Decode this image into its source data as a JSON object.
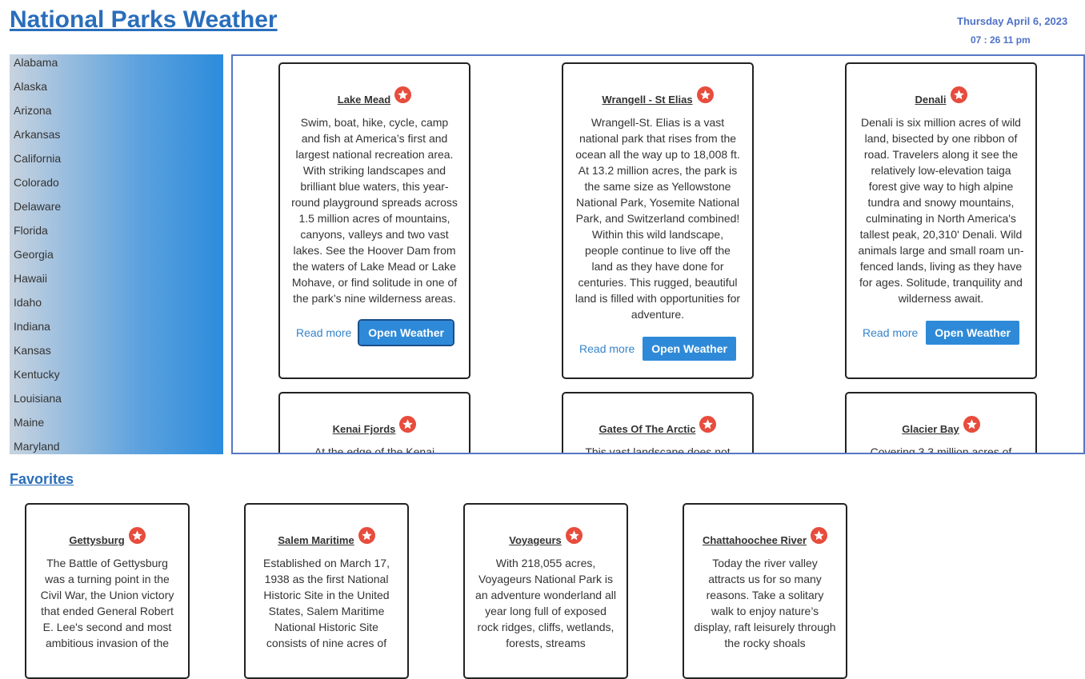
{
  "header": {
    "title": "National Parks Weather",
    "date": "Thursday April 6, 2023",
    "time": "07 : 26 11 pm"
  },
  "states": [
    "Alabama",
    "Alaska",
    "Arizona",
    "Arkansas",
    "California",
    "Colorado",
    "Delaware",
    "Florida",
    "Georgia",
    "Hawaii",
    "Idaho",
    "Indiana",
    "Kansas",
    "Kentucky",
    "Louisiana",
    "Maine",
    "Maryland"
  ],
  "parks": [
    {
      "name": "Lake Mead",
      "description": "Swim, boat, hike, cycle, camp and fish at America’s first and largest national recreation area. With striking landscapes and brilliant blue waters, this year-round playground spreads across 1.5 million acres of mountains, canyons, valleys and two vast lakes. See the Hoover Dam from the waters of Lake Mead or Lake Mohave, or find solitude in one of the park’s nine wilderness areas.",
      "read_more": "Read more",
      "weather_label": "Open Weather"
    },
    {
      "name": "Wrangell - St Elias",
      "description": "Wrangell-St. Elias is a vast national park that rises from the ocean all the way up to 18,008 ft. At 13.2 million acres, the park is the same size as Yellowstone National Park, Yosemite National Park, and Switzerland combined! Within this wild landscape, people continue to live off the land as they have done for centuries. This rugged, beautiful land is filled with opportunities for adventure.",
      "read_more": "Read more",
      "weather_label": "Open Weather"
    },
    {
      "name": "Denali",
      "description": "Denali is six million acres of wild land, bisected by one ribbon of road. Travelers along it see the relatively low-elevation taiga forest give way to high alpine tundra and snowy mountains, culminating in North America's tallest peak, 20,310' Denali. Wild animals large and small roam un-fenced lands, living as they have for ages. Solitude, tranquility and wilderness await.",
      "read_more": "Read more",
      "weather_label": "Open Weather"
    },
    {
      "name": "Kenai Fjords",
      "description": "At the edge of the Kenai"
    },
    {
      "name": "Gates Of The Arctic",
      "description": "This vast landscape does not"
    },
    {
      "name": "Glacier Bay",
      "description": "Covering 3.3 million acres of"
    }
  ],
  "favorites": {
    "title": "Favorites",
    "items": [
      {
        "name": "Gettysburg",
        "description": "The Battle of Gettysburg was a turning point in the Civil War, the Union victory that ended General Robert E. Lee's second and most ambitious invasion of the"
      },
      {
        "name": "Salem Maritime",
        "description": "Established on March 17, 1938 as the first National Historic Site in the United States, Salem Maritime National Historic Site consists of nine acres of"
      },
      {
        "name": "Voyageurs",
        "description": "With 218,055 acres, Voyageurs National Park is an adventure wonderland all year long full of exposed rock ridges, cliffs, wetlands, forests, streams"
      },
      {
        "name": "Chattahoochee River",
        "description": "Today the river valley attracts us for so many reasons. Take a solitary walk to enjoy nature’s display, raft leisurely through the rocky shoals"
      }
    ]
  },
  "colors": {
    "title": "#2a6ebb",
    "accent_button": "#2e8ad8",
    "star": "#e74c3c",
    "panel_border": "#5677c5"
  }
}
